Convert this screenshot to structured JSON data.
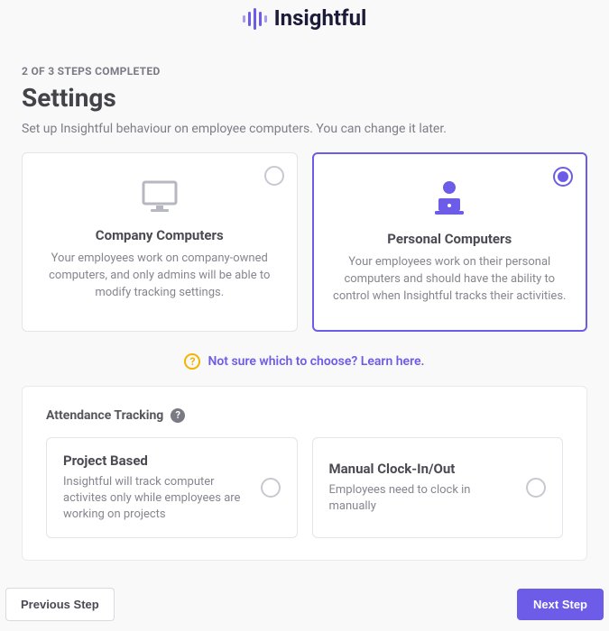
{
  "brand": {
    "name": "Insightful"
  },
  "progress": {
    "label": "2 OF 3 STEPS COMPLETED"
  },
  "page": {
    "title": "Settings",
    "subtitle": "Set up Insightful behaviour on employee computers. You can change it later."
  },
  "computer_type": {
    "options": [
      {
        "id": "company",
        "title": "Company Computers",
        "description": "Your employees work on company-owned computers, and only admins will be able to modify tracking settings.",
        "selected": false
      },
      {
        "id": "personal",
        "title": "Personal Computers",
        "description": "Your employees work on their personal computers and should have the ability to control when Insightful tracks their activities.",
        "selected": true
      }
    ]
  },
  "help": {
    "text": "Not sure which to choose? Learn here."
  },
  "attendance": {
    "heading": "Attendance Tracking",
    "options": [
      {
        "id": "project_based",
        "title": "Project Based",
        "description": "Insightful will track computer activites only while employees are working on projects",
        "selected": false
      },
      {
        "id": "manual",
        "title": "Manual Clock-In/Out",
        "description": "Employees need to clock in manually",
        "selected": false
      }
    ]
  },
  "footer": {
    "previous_label": "Previous Step",
    "next_label": "Next Step"
  },
  "colors": {
    "accent": "#6C5CE7",
    "help_icon": "#f5b301"
  }
}
